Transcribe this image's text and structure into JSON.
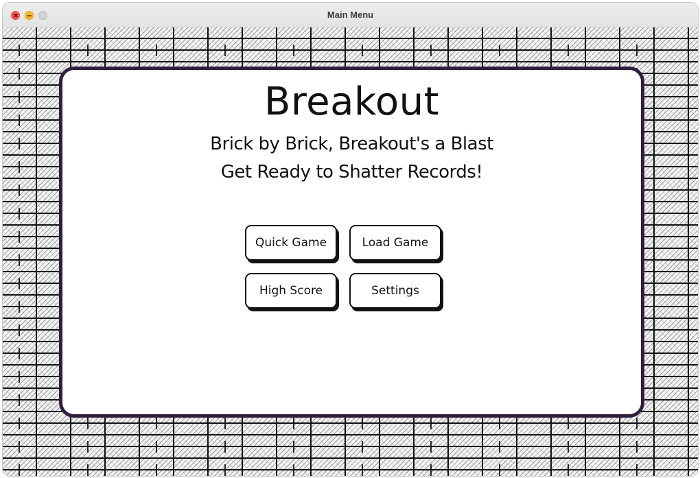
{
  "window": {
    "title": "Main Menu"
  },
  "game": {
    "title": "Breakout",
    "tagline_line1": "Brick by Brick, Breakout's a Blast",
    "tagline_line2": "Get Ready to Shatter Records!"
  },
  "menu": {
    "quick_game": "Quick Game",
    "load_game": "Load Game",
    "high_score": "High Score",
    "settings": "Settings"
  },
  "colors": {
    "panel_border": "#2f1f3f",
    "close": "#ff5f57",
    "minimize": "#febc2e",
    "maximize_disabled": "#d2d2d2"
  },
  "icons": {
    "close": "close-icon",
    "minimize": "minimize-icon",
    "maximize": "maximize-icon"
  }
}
